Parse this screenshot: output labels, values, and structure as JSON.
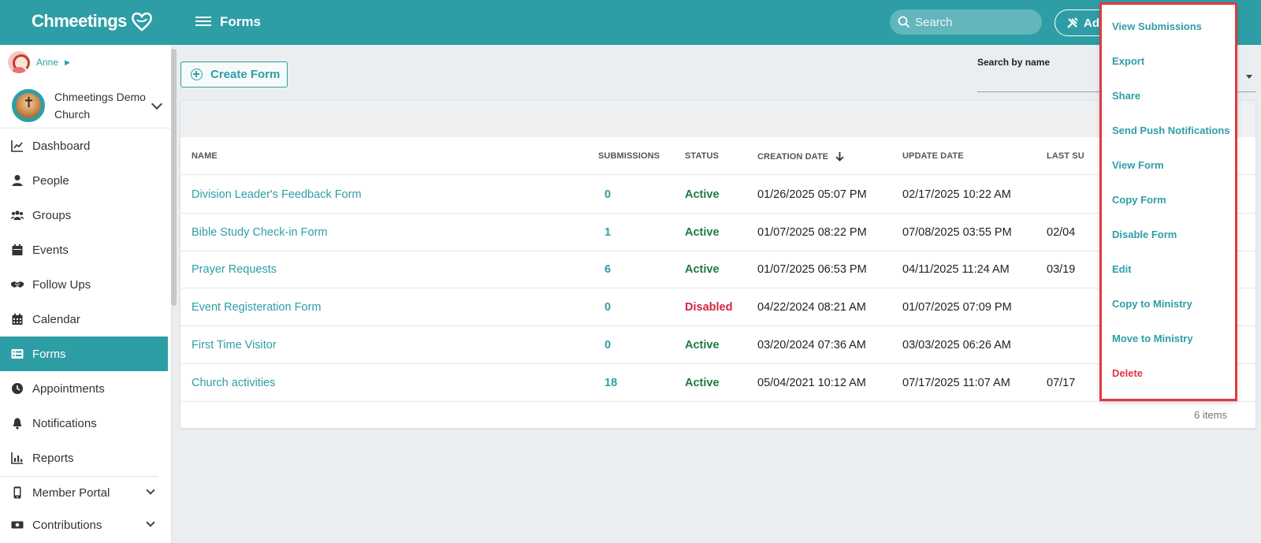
{
  "app": {
    "logo_text": "Chmeetings",
    "page_title": "Forms",
    "search_placeholder": "Search",
    "add_label": "Ad"
  },
  "sidebar": {
    "user_name": "Anne",
    "church_name": "Chmeetings Demo Church",
    "items": [
      {
        "label": "Dashboard",
        "icon": "chart-line-icon"
      },
      {
        "label": "People",
        "icon": "person-icon"
      },
      {
        "label": "Groups",
        "icon": "users-icon"
      },
      {
        "label": "Events",
        "icon": "calendar-icon"
      },
      {
        "label": "Follow Ups",
        "icon": "handshake-icon"
      },
      {
        "label": "Calendar",
        "icon": "calendar-grid-icon"
      },
      {
        "label": "Forms",
        "icon": "list-icon",
        "active": true
      },
      {
        "label": "Appointments",
        "icon": "clock-icon"
      },
      {
        "label": "Notifications",
        "icon": "bell-icon"
      },
      {
        "label": "Reports",
        "icon": "bar-chart-icon"
      },
      {
        "label": "Member Portal",
        "icon": "mobile-icon",
        "expandable": true
      },
      {
        "label": "Contributions",
        "icon": "money-icon",
        "expandable": true
      }
    ]
  },
  "main": {
    "create_label": "Create Form",
    "search_by_name_label": "Search by name",
    "columns": [
      "NAME",
      "SUBMISSIONS",
      "STATUS",
      "CREATION DATE",
      "UPDATE DATE",
      "LAST SU"
    ],
    "rows": [
      {
        "name": "Division Leader's Feedback Form",
        "submissions": "0",
        "status": "Active",
        "created": "01/26/2025 05:07 PM",
        "updated": "02/17/2025 10:22 AM",
        "last": ""
      },
      {
        "name": "Bible Study Check-in Form",
        "submissions": "1",
        "status": "Active",
        "created": "01/07/2025 08:22 PM",
        "updated": "07/08/2025 03:55 PM",
        "last": "02/04"
      },
      {
        "name": "Prayer Requests",
        "submissions": "6",
        "status": "Active",
        "created": "01/07/2025 06:53 PM",
        "updated": "04/11/2025 11:24 AM",
        "last": "03/19"
      },
      {
        "name": "Event Registeration Form",
        "submissions": "0",
        "status": "Disabled",
        "created": "04/22/2024 08:21 AM",
        "updated": "01/07/2025 07:09 PM",
        "last": ""
      },
      {
        "name": "First Time Visitor",
        "submissions": "0",
        "status": "Active",
        "created": "03/20/2024 07:36 AM",
        "updated": "03/03/2025 06:26 AM",
        "last": ""
      },
      {
        "name": "Church activities",
        "submissions": "18",
        "status": "Active",
        "created": "05/04/2021 10:12 AM",
        "updated": "07/17/2025 11:07 AM",
        "last": "07/17"
      }
    ],
    "items_count": "6 items"
  },
  "context_menu": {
    "items": [
      {
        "label": "View Submissions"
      },
      {
        "label": "Export"
      },
      {
        "label": "Share"
      },
      {
        "label": "Send Push Notifications"
      },
      {
        "label": "View Form"
      },
      {
        "label": "Copy Form"
      },
      {
        "label": "Disable Form"
      },
      {
        "label": "Edit"
      },
      {
        "label": "Copy to Ministry"
      },
      {
        "label": "Move to Ministry"
      },
      {
        "label": "Delete",
        "danger": true
      }
    ]
  },
  "colors": {
    "brand": "#2e9ea6",
    "active_status": "#1f7a3d",
    "disabled_status": "#d1283f",
    "highlight_border": "#e03a3e"
  }
}
